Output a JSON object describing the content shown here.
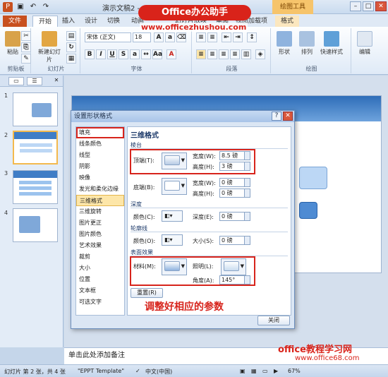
{
  "window": {
    "title": "演示文稿2 - Mi",
    "context_tool": "绘图工具"
  },
  "brand": {
    "name": "Office办公助手",
    "url": "www.officezhushou.com"
  },
  "tabs": [
    "文件",
    "开始",
    "插入",
    "设计",
    "切换",
    "动画",
    "幻灯片放映",
    "审阅",
    "视图",
    "加载项",
    "格式"
  ],
  "ribbon": {
    "groups": [
      "剪贴板",
      "幻灯片",
      "字体",
      "段落",
      "绘图"
    ],
    "paste": "粘贴",
    "new_slide": "新建幻灯片",
    "font_name": "宋体 (正文)",
    "font_size": "18",
    "shape": "形状",
    "arrange": "排列",
    "quick_styles": "快速样式",
    "edit": "编辑"
  },
  "slides": [
    "1",
    "2",
    "3",
    "4"
  ],
  "notes_placeholder": "单击此处添加备注",
  "status": {
    "slide_info": "幻灯片 第 2 张，共 4 张",
    "theme": "\"EPPT Template\"",
    "language": "中文(中国)",
    "zoom": "67%"
  },
  "footer_brand": {
    "name": "office教程学习网",
    "url": "www.office68.com"
  },
  "dialog": {
    "title": "设置形状格式",
    "nav": [
      "填充",
      "线条颜色",
      "线型",
      "阴影",
      "映像",
      "发光和柔化边缘",
      "三维格式",
      "三维旋转",
      "图片更正",
      "图片颜色",
      "艺术效果",
      "裁剪",
      "大小",
      "位置",
      "文本框",
      "可选文字"
    ],
    "selected_nav": "三维格式",
    "panel_title": "三维格式",
    "bevel_section": "棱台",
    "top_label": "顶端(T):",
    "bottom_label": "底端(B):",
    "width_label": "宽度(W):",
    "height_label": "高度(H):",
    "top_width": "8.5 磅",
    "top_height": "3 磅",
    "bottom_width": "0 磅",
    "bottom_height": "0 磅",
    "depth_section": "深度",
    "depth_color_label": "颜色(C):",
    "depth_label": "深度(E):",
    "depth_value": "0 磅",
    "contour_section": "轮廓线",
    "contour_color_label": "颜色(O):",
    "size_label": "大小(S):",
    "size_value": "0 磅",
    "surface_section": "表面效果",
    "material_label": "材料(M):",
    "lighting_label": "照明(L):",
    "angle_label": "角度(A):",
    "angle_value": "145°",
    "reset": "重置(R)",
    "annotation": "调整好相应的参数",
    "close": "关闭"
  }
}
